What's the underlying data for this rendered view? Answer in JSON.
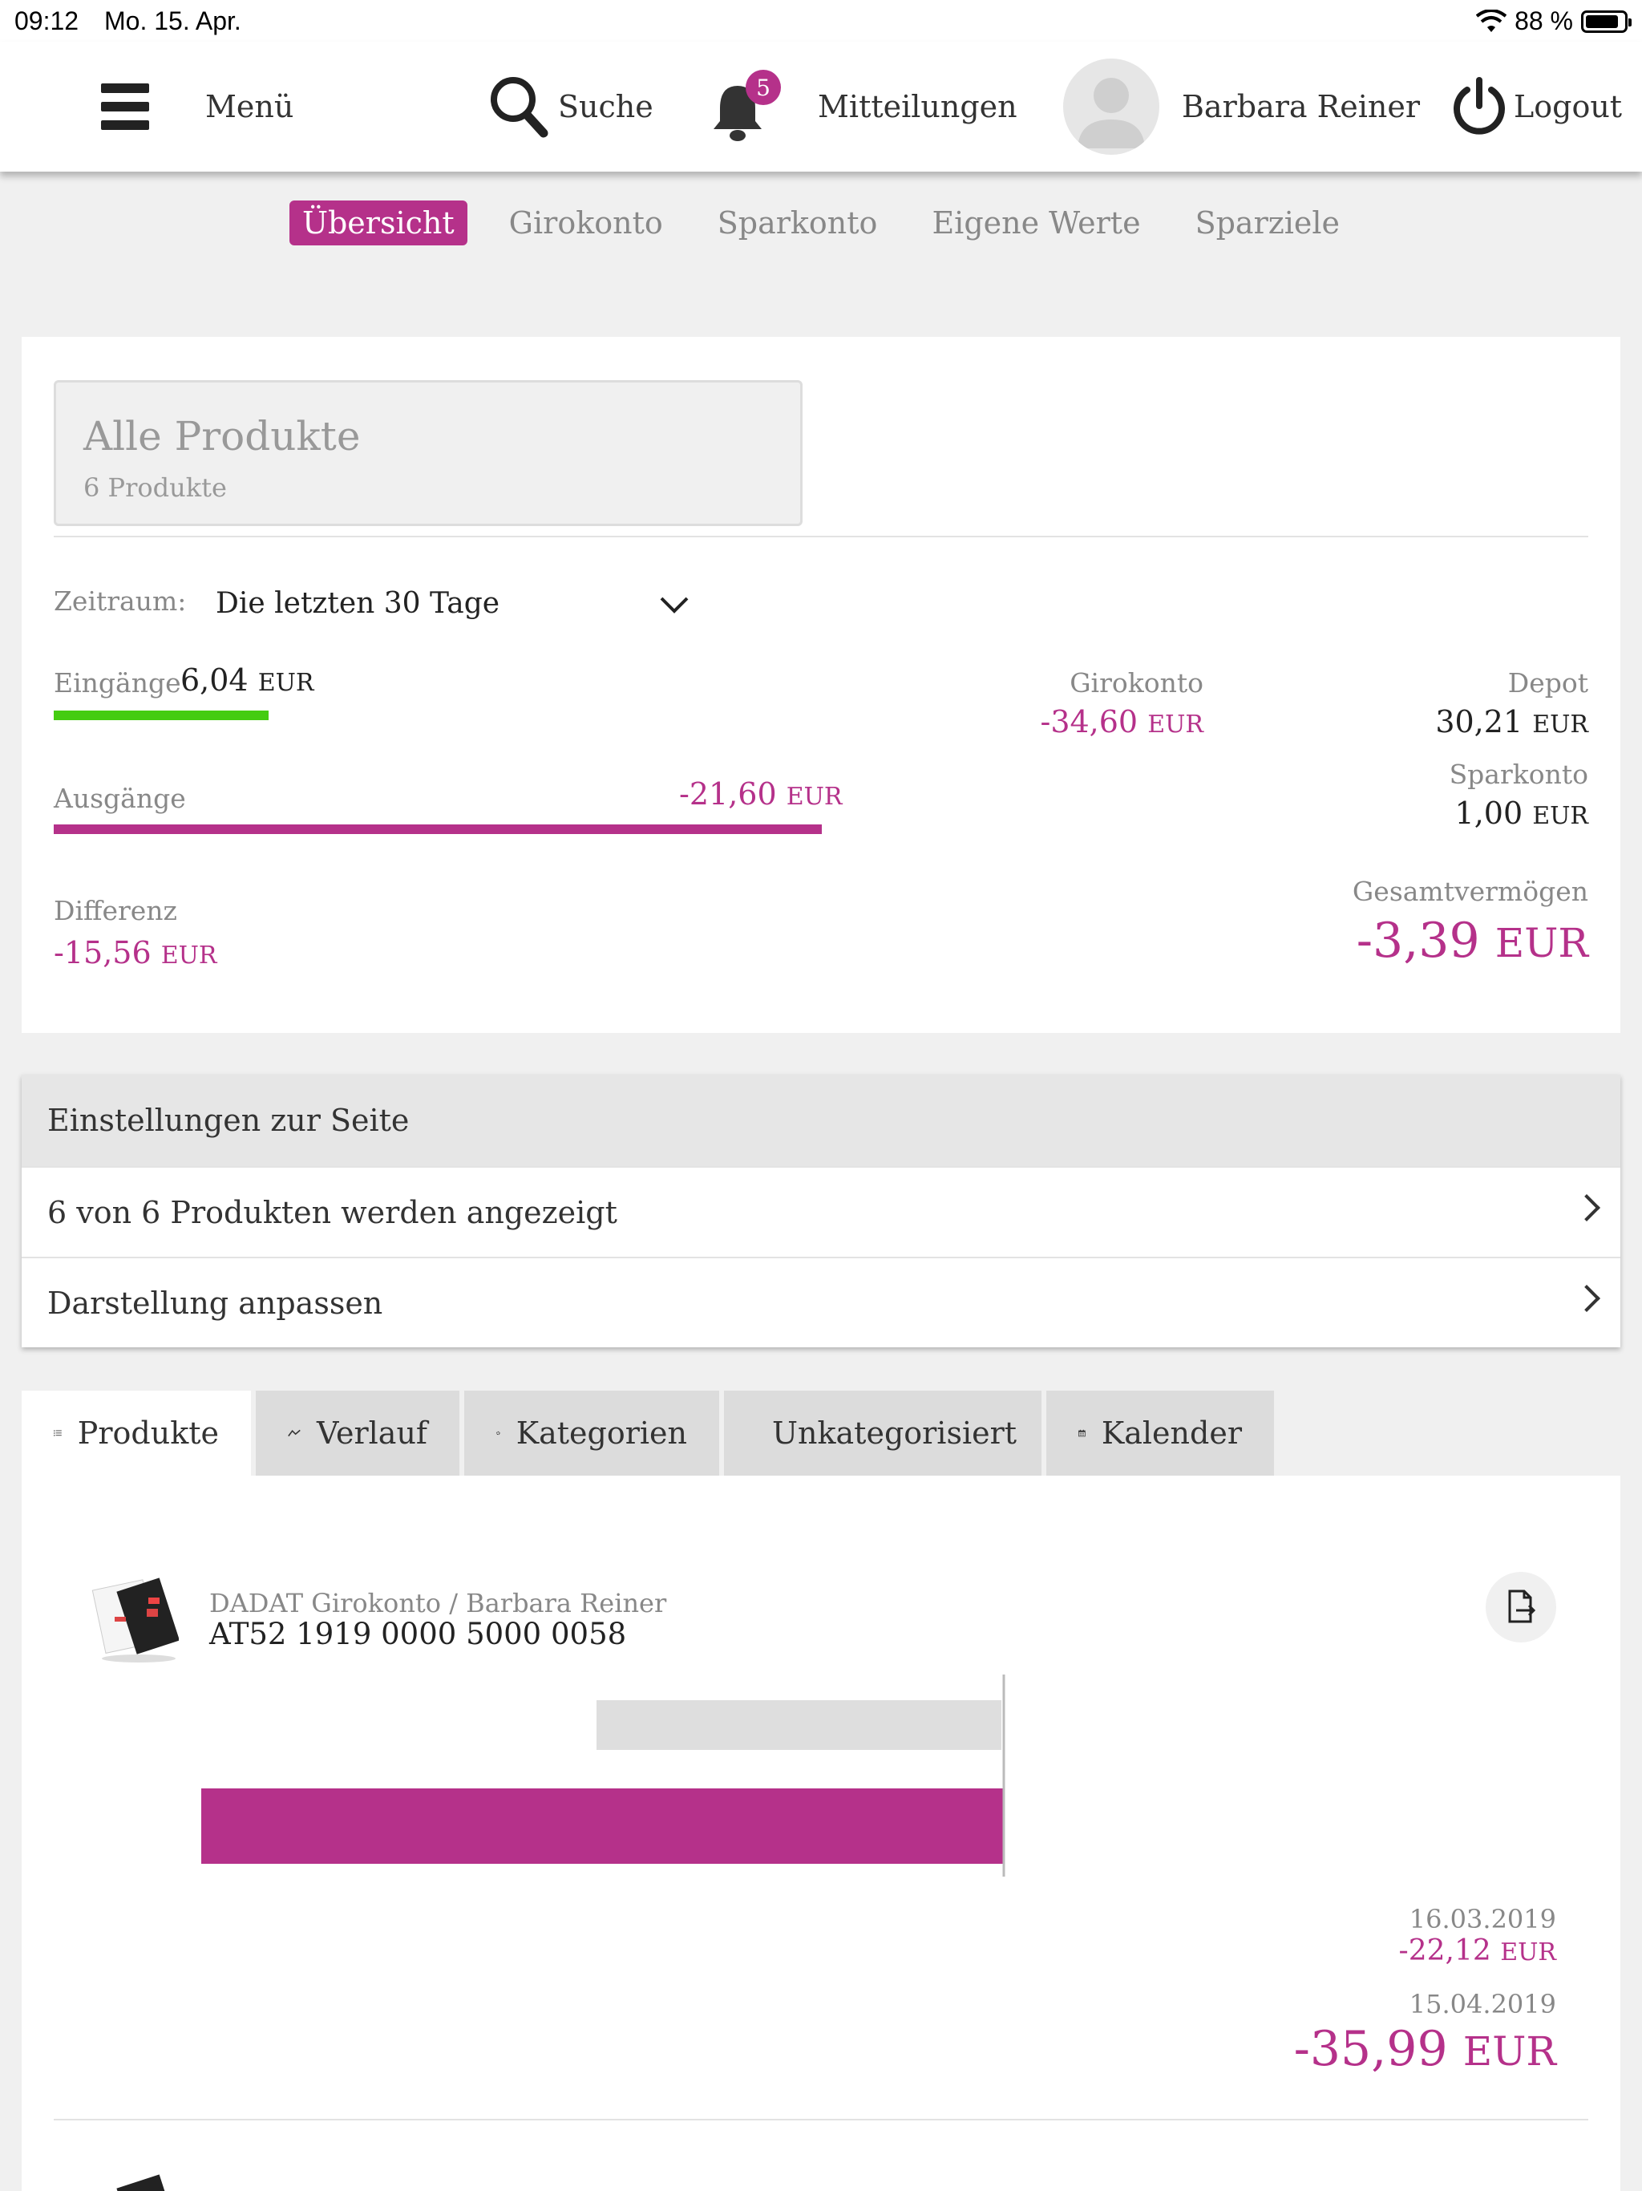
{
  "status_bar": {
    "time": "09:12",
    "date": "Mo. 15. Apr.",
    "battery": "88 %"
  },
  "top_nav": {
    "menu_label": "Menü",
    "search_label": "Suche",
    "notifications_count": "5",
    "messages_label": "Mitteilungen",
    "user_name": "Barbara Reiner",
    "logout_label": "Logout"
  },
  "sub_nav": {
    "tabs": [
      "Übersicht",
      "Girokonto",
      "Sparkonto",
      "Eigene Werte",
      "Sparziele"
    ],
    "active": 0
  },
  "summary": {
    "product_title": "Alle Produkte",
    "product_count": "6 Produkte",
    "period_label": "Zeitraum:",
    "period_value": "Die letzten 30 Tage",
    "income_label": "Eingänge",
    "income_value": "6,04",
    "expense_label": "Ausgänge",
    "expense_value": "-21,60",
    "diff_label": "Differenz",
    "diff_value": "-15,56",
    "currency": "EUR",
    "girokonto_label": "Girokonto",
    "girokonto_value": "-34,60",
    "depot_label": "Depot",
    "depot_value": "30,21",
    "sparkonto_label": "Sparkonto",
    "sparkonto_value": "1,00",
    "total_label": "Gesamtvermögen",
    "total_value": "-3,39"
  },
  "settings": {
    "title": "Einstellungen zur Seite",
    "row1": "6 von 6 Produkten werden angezeigt",
    "row2": "Darstellung anpassen"
  },
  "view_tabs": [
    "Produkte",
    "Verlauf",
    "Kategorien",
    "Unkategorisiert",
    "Kalender"
  ],
  "product": {
    "name": "DADAT Girokonto / Barbara Reiner",
    "iban": "AT52 1919 0000 5000 0058",
    "date_start": "16.03.2019",
    "value_start": "-22,12",
    "date_end": "15.04.2019",
    "value_end": "-35,99",
    "currency": "EUR"
  },
  "colors": {
    "accent": "#b5318a",
    "income": "#44cc11",
    "grey_bar": "#dedede"
  }
}
